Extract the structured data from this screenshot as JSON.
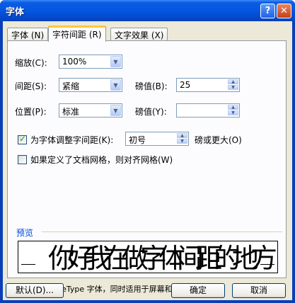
{
  "window": {
    "title": "字体",
    "help": "?",
    "close": "✕"
  },
  "tabs": [
    {
      "label": "字体 (N)"
    },
    {
      "label": "字符间距 (R)"
    },
    {
      "label": "文字效果 (X)"
    }
  ],
  "spacing": {
    "scale_label": "缩放(C):",
    "scale_value": "100%",
    "spacing_label": "间距(S):",
    "spacing_value": "紧缩",
    "spacing_by_label": "磅值(B):",
    "spacing_by_value": "25",
    "position_label": "位置(P):",
    "position_value": "标准",
    "position_by_label": "磅值(Y):",
    "position_by_value": ""
  },
  "kerning": {
    "checked": true,
    "label": "为字体调整字间距(K):",
    "value": "初号",
    "suffix": "磅或更大(O)"
  },
  "grid": {
    "checked": false,
    "label": "如果定义了文档网格，则对齐网格(W)"
  },
  "preview": {
    "group_label": "预览",
    "sample": "你好我在做字体间距的地方",
    "note": "这是一种 TrueType 字体，同时适用于屏幕和打印机。"
  },
  "buttons": {
    "default": "默认(D)...",
    "ok": "确定",
    "cancel": "取消"
  },
  "colors": {
    "title_bar": "#0556e0",
    "dialog_bg": "#ece9d8",
    "group_label": "#0046d5"
  }
}
